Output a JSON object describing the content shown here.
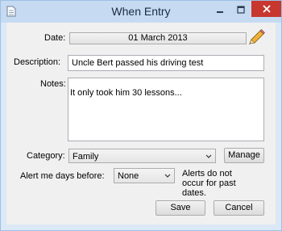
{
  "window": {
    "title": "When Entry",
    "app_icon": "document-icon",
    "controls": {
      "minimize": "minimize-icon",
      "maximize": "maximize-icon",
      "close": "close-icon"
    },
    "close_color": "#c7372f"
  },
  "form": {
    "date_label": "Date:",
    "date_value": "01 March 2013",
    "edit_icon": "pencil-icon",
    "description_label": "Description:",
    "description_value": "Uncle Bert passed his driving test",
    "notes_label": "Notes:",
    "notes_value": "It only took him 30 lessons...",
    "category_label": "Category:",
    "category_value": "Family",
    "manage_label": "Manage",
    "alert_label": "Alert me days before:",
    "alert_value": "None",
    "alert_note": "Alerts do not occur for past dates.",
    "save_label": "Save",
    "cancel_label": "Cancel"
  }
}
